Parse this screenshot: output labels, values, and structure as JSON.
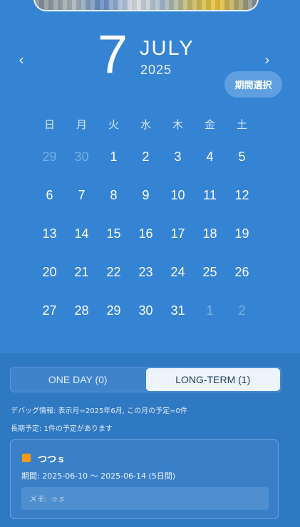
{
  "header": {
    "day": "7",
    "month": "JULY",
    "year": "2025",
    "prev_icon": "‹",
    "next_icon": "›",
    "period_button": "期間選択"
  },
  "calendar": {
    "weekdays": [
      "日",
      "月",
      "火",
      "水",
      "木",
      "金",
      "土"
    ],
    "weeks": [
      [
        {
          "d": "29",
          "m": true
        },
        {
          "d": "30",
          "m": true
        },
        {
          "d": "1"
        },
        {
          "d": "2"
        },
        {
          "d": "3"
        },
        {
          "d": "4"
        },
        {
          "d": "5"
        }
      ],
      [
        {
          "d": "6"
        },
        {
          "d": "7"
        },
        {
          "d": "8"
        },
        {
          "d": "9"
        },
        {
          "d": "10"
        },
        {
          "d": "11"
        },
        {
          "d": "12"
        }
      ],
      [
        {
          "d": "13"
        },
        {
          "d": "14"
        },
        {
          "d": "15"
        },
        {
          "d": "16"
        },
        {
          "d": "17"
        },
        {
          "d": "18"
        },
        {
          "d": "19"
        }
      ],
      [
        {
          "d": "20"
        },
        {
          "d": "21"
        },
        {
          "d": "22"
        },
        {
          "d": "23"
        },
        {
          "d": "24"
        },
        {
          "d": "25"
        },
        {
          "d": "26"
        }
      ],
      [
        {
          "d": "27"
        },
        {
          "d": "28"
        },
        {
          "d": "29"
        },
        {
          "d": "30"
        },
        {
          "d": "31"
        },
        {
          "d": "1",
          "m": true
        },
        {
          "d": "2",
          "m": true
        }
      ]
    ]
  },
  "tabs": {
    "one_day": "ONE DAY (0)",
    "long_term": "LONG-TERM (1)",
    "active": "long_term"
  },
  "info": {
    "debug": "デバッグ情報: 表示月=2025年6月, この月の予定=0件",
    "long_term_note": "長期予定: 1件の予定があります"
  },
  "event": {
    "title": "つつｓ",
    "period": "期間: 2025-06-10 〜 2025-06-14 (5日間)",
    "memo": "メモ: っｓ",
    "color": "#f39c12"
  },
  "colors": {
    "background": "#3584d4",
    "bottom_panel": "#2f78c2",
    "accent_orange": "#f39c12"
  }
}
